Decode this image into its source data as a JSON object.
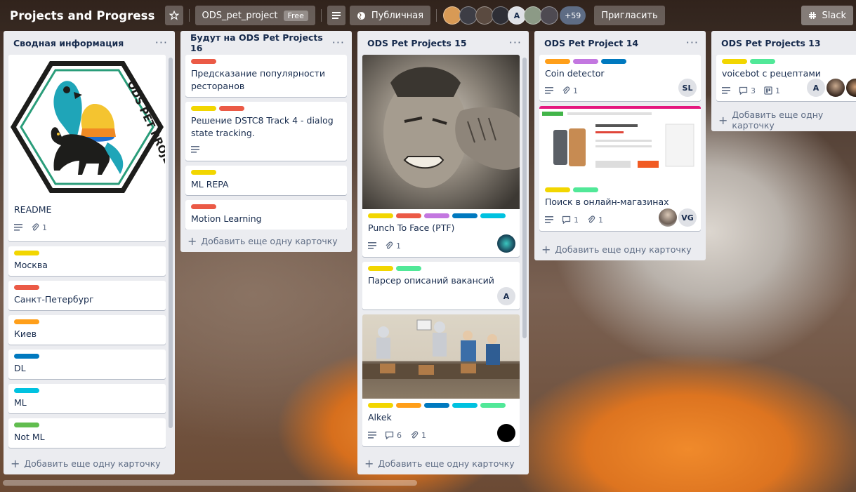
{
  "header": {
    "board_title": "Projects and Progress",
    "workspace_name": "ODS_pet_project",
    "workspace_badge": "Free",
    "visibility": "Публичная",
    "member_initial": "A",
    "more_members": "+59",
    "invite_label": "Пригласить",
    "powerup_label": "Slack"
  },
  "colors": {
    "yellow": "#f2d600",
    "red": "#eb5a46",
    "orange": "#ff9f1a",
    "purple": "#c377e0",
    "blue": "#0079bf",
    "sky": "#00c2e0",
    "lime": "#51e898",
    "green": "#61bd4f"
  },
  "lists": [
    {
      "title": "Сводная информация",
      "cards": [
        {
          "title": "README",
          "attachments": "1"
        },
        {
          "title": "Москва"
        },
        {
          "title": "Санкт-Петербург"
        },
        {
          "title": "Киев"
        },
        {
          "title": "DL"
        },
        {
          "title": "ML"
        },
        {
          "title": "Not ML"
        }
      ],
      "add_label": "Добавить еще одну карточку"
    },
    {
      "title": "Будут на ODS Pet Projects 16",
      "cards": [
        {
          "title": "Предсказание популярности ресторанов"
        },
        {
          "title": "Решение DSTC8 Track 4 - dialog state tracking."
        },
        {
          "title": "ML REPA"
        },
        {
          "title": "Motion Learning"
        }
      ],
      "add_label": "Добавить еще одну карточку"
    },
    {
      "title": "ODS Pet Projects 15",
      "cards": [
        {
          "title": "Punch To Face (PTF)",
          "attachments": "1"
        },
        {
          "title": "Парсер описаний вакансий",
          "member": "A"
        },
        {
          "title": "Alkek",
          "comments": "6",
          "attachments": "1"
        }
      ],
      "add_label": "Добавить еще одну карточку"
    },
    {
      "title": "ODS Pet Project 14",
      "cards": [
        {
          "title": "Coin detector",
          "attachments": "1",
          "member": "SL"
        },
        {
          "title": "Поиск в онлайн-магазинах",
          "comments": "1",
          "attachments": "1",
          "member": "VG"
        }
      ],
      "add_label": "Добавить еще одну карточку"
    },
    {
      "title": "ODS Pet Projects 13",
      "cards": [
        {
          "title": "voicebot с рецептами",
          "comments": "3",
          "checklist": "1",
          "member": "A"
        }
      ],
      "add_label": "Добавить еще одну карточку"
    }
  ],
  "logo_text": "ODS PET PROJECTS"
}
